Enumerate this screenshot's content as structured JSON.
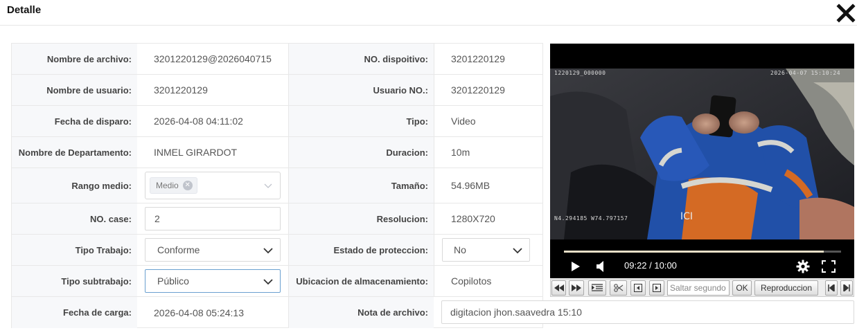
{
  "header": {
    "title": "Detalle"
  },
  "rows": [
    {
      "label1": "Nombre de archivo:",
      "value1": "3201220129@2026040715",
      "label2": "NO. dispoitivo:",
      "value2": "3201220129"
    },
    {
      "label1": "Nombre de usuario:",
      "value1": "3201220129",
      "label2": "Usuario NO.:",
      "value2": "3201220129"
    },
    {
      "label1": "Fecha de disparo:",
      "value1": "2026-04-08 04:11:02",
      "label2": "Tipo:",
      "value2": "Video"
    },
    {
      "label1": "Nombre de Departamento:",
      "value1": "INMEL GIRARDOT",
      "label2": "Duracion:",
      "value2": "10m"
    },
    {
      "label1": "Rango medio:",
      "tag": "Medio",
      "label2": "Tamaño:",
      "value2": "54.96MB"
    },
    {
      "label1": "NO. case:",
      "value1": "2",
      "label2": "Resolucion:",
      "value2": "1280X720"
    },
    {
      "label1": "Tipo Trabajo:",
      "value1": "Conforme",
      "label2": "Estado de proteccion:",
      "value2": "No"
    },
    {
      "label1": "Tipo subtrabajo:",
      "value1": "Público",
      "label2": "Ubicacion de almacenamiento:",
      "value2": "Copilotos"
    },
    {
      "label1": "Fecha de carga:",
      "value1": "2026-04-08 05:24:13",
      "label2": "Nota de archivo:",
      "value2": "digitacion jhon.saavedra 15:10"
    }
  ],
  "player": {
    "osd_top_left": "1220129_000000",
    "osd_top_right": "2026-04-07 15:10:24",
    "osd_bottom_left": "N4.294185 W74.797157",
    "time": "09:22 / 10:00",
    "progress": 0.937
  },
  "toolbar": {
    "seek_placeholder": "Saltar segundo",
    "ok_label": "OK",
    "playback_label": "Reproduccion"
  }
}
